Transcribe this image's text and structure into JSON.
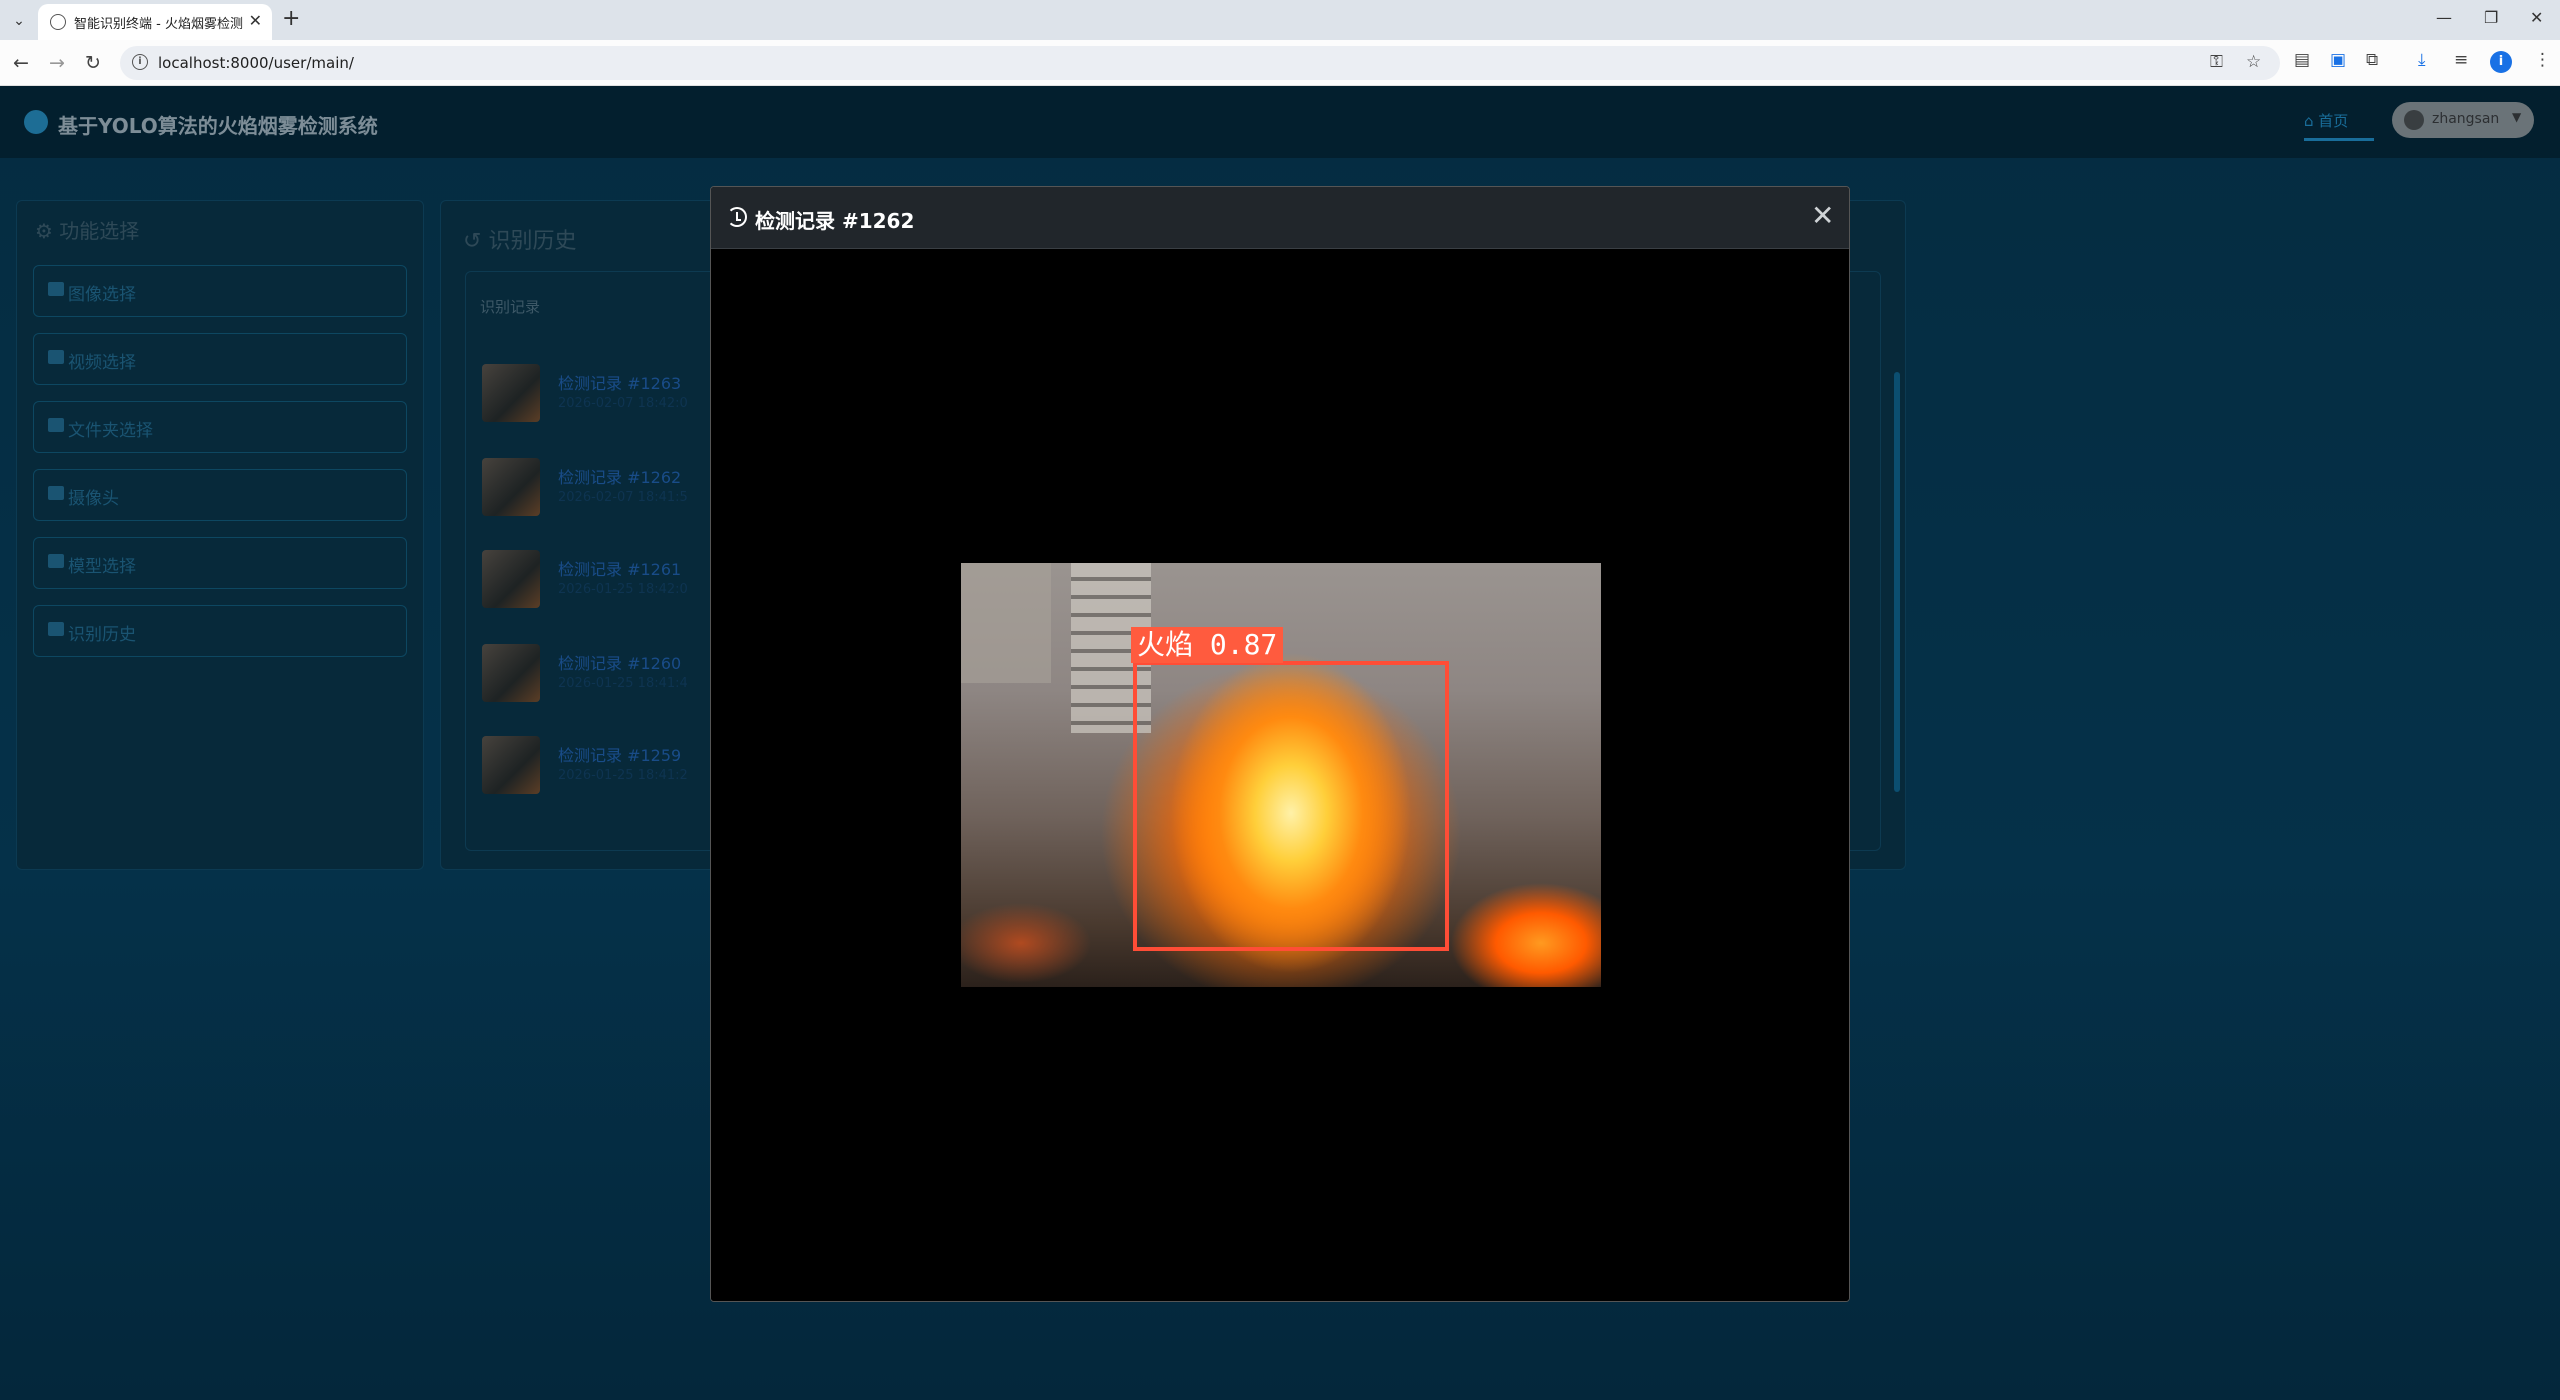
{
  "browser": {
    "tab_title": "智能识别终端 - 火焰烟雾检测系统",
    "url": "localhost:8000/user/main/",
    "profile_initial": "i"
  },
  "app": {
    "title": "基于YOLO算法的火焰烟雾检测系统",
    "nav_home": "首页",
    "username": "zhangsan"
  },
  "sidebar": {
    "title": "功能选择",
    "items": [
      {
        "label": "图像选择"
      },
      {
        "label": "视频选择"
      },
      {
        "label": "文件夹选择"
      },
      {
        "label": "摄像头"
      },
      {
        "label": "模型选择"
      },
      {
        "label": "识别历史"
      }
    ]
  },
  "history": {
    "title": "识别历史",
    "card_title": "识别记录",
    "records": [
      {
        "name": "检测记录 #1263",
        "time": "2026-02-07 18:42:0"
      },
      {
        "name": "检测记录 #1262",
        "time": "2026-02-07 18:41:5"
      },
      {
        "name": "检测记录 #1261",
        "time": "2026-01-25 18:42:0"
      },
      {
        "name": "检测记录 #1260",
        "time": "2026-01-25 18:41:4"
      },
      {
        "name": "检测记录 #1259",
        "time": "2026-01-25 18:41:2"
      }
    ]
  },
  "modal": {
    "title": "检测记录 #1262",
    "detection_label": "火焰 0.87"
  },
  "colors": {
    "modal_header": "#21262b",
    "bbox": "#ff4d36",
    "page_bg": "#0a2c40"
  }
}
